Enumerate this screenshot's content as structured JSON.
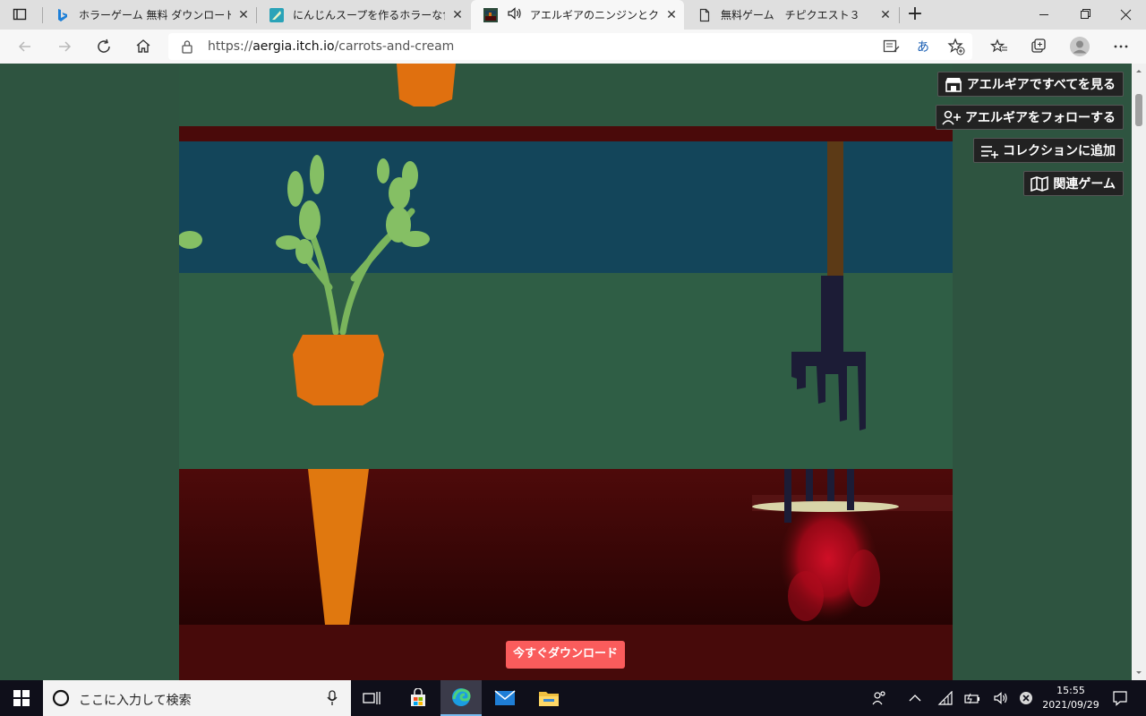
{
  "browser": {
    "tabs": [
      {
        "title": "ホラーゲーム 無料 ダウンロードなし - B",
        "icon": "bing-icon"
      },
      {
        "title": "にんじんスープを作るホラーな食べ物ゲ",
        "icon": "site-icon"
      },
      {
        "title": "アエルギアのニンジンとクリーム",
        "icon": "itch-icon",
        "audio": true
      },
      {
        "title": "無料ゲーム　チピクエスト３",
        "icon": "page-icon"
      }
    ],
    "new_tab": "+",
    "url_prefix": "https://",
    "url_host": "aergia.itch.io",
    "url_path": "/carrots-and-cream",
    "read_aloud": "あ"
  },
  "page": {
    "sidebar_buttons": [
      {
        "label": "アエルギアですべてを見る",
        "icon": "store-icon"
      },
      {
        "label": "アエルギアをフォローする",
        "icon": "follow-icon"
      },
      {
        "label": "コレクションに追加",
        "icon": "collection-icon"
      },
      {
        "label": "関連ゲーム",
        "icon": "map-icon"
      }
    ],
    "download_label": "今すぐダウンロード"
  },
  "taskbar": {
    "search_placeholder": "ここに入力して検索",
    "time": "15:55",
    "date": "2021/09/29"
  },
  "colors": {
    "page_bg": "#2e5440",
    "download": "#fa5c5c",
    "carrot": "#e0700f",
    "sky": "#13455a",
    "soil": "#4a0a0a"
  }
}
